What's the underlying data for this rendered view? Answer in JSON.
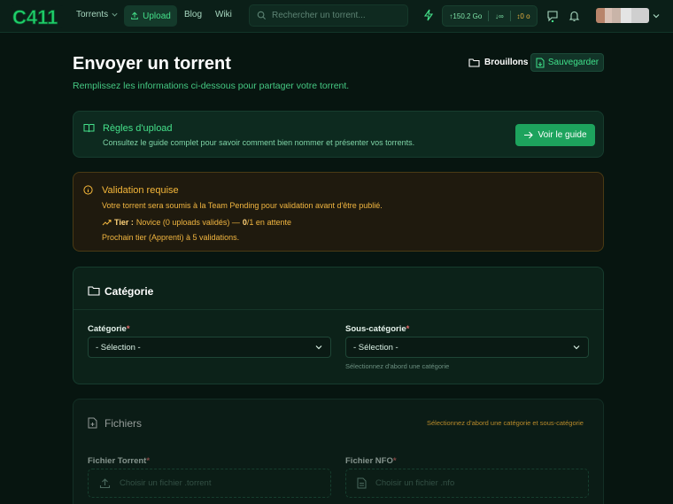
{
  "nav": {
    "logo_text": "C411",
    "torrents": "Torrents",
    "upload": "Upload",
    "blog": "Blog",
    "wiki": "Wiki",
    "search_placeholder": "Rechercher un torrent...",
    "upload_stat": "150.2 Go",
    "download_stat": "∞",
    "ratio_stat": "0 o"
  },
  "page": {
    "title": "Envoyer un torrent",
    "subtitle": "Remplissez les informations ci-dessous pour partager votre torrent.",
    "drafts_label": "Brouillons",
    "save_label": "Sauvegarder"
  },
  "rules": {
    "title": "Règles d'upload",
    "text": "Consultez le guide complet pour savoir comment bien nommer et présenter vos torrents.",
    "button": "Voir le guide"
  },
  "validation": {
    "title": "Validation requise",
    "line1": "Votre torrent sera soumis à la Team Pending pour validation avant d'être publié.",
    "tier_label": "Tier :",
    "tier_value": "Novice (0 uploads validés) —",
    "tier_count": "0",
    "tier_rest": "/1 en attente",
    "line3": "Prochain tier (Apprenti) à 5 validations."
  },
  "category_section": {
    "title": "Catégorie",
    "category_label": "Catégorie",
    "category_value": "- Sélection -",
    "subcategory_label": "Sous-catégorie",
    "subcategory_value": "- Sélection -",
    "subcategory_help": "Sélectionnez d'abord une catégorie",
    "required_mark": "*"
  },
  "files_section": {
    "title": "Fichiers",
    "hint": "Sélectionnez d'abord une catégorie et sous-catégorie",
    "torrent_label": "Fichier Torrent",
    "torrent_placeholder": "Choisir un fichier .torrent",
    "nfo_label": "Fichier NFO",
    "nfo_placeholder": "Choisir un fichier .nfo"
  },
  "colors": {
    "accent": "#45e08a",
    "background": "#071510",
    "warning": "#f2b640"
  }
}
